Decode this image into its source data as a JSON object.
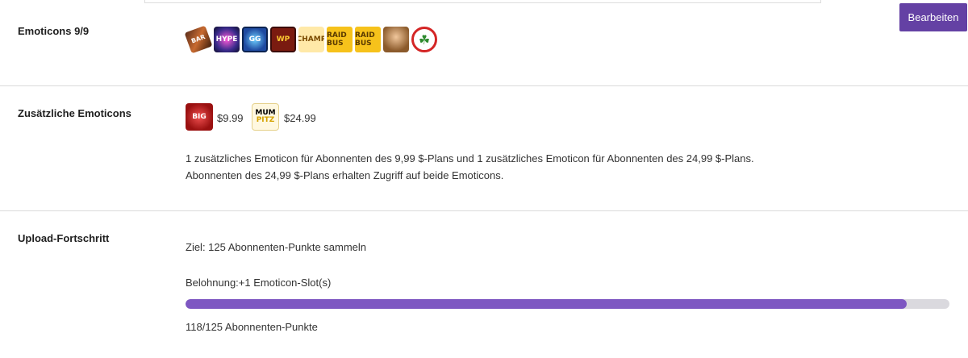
{
  "header": {
    "edit_label": "Bearbeiten"
  },
  "emoticons": {
    "label": "Emoticons 9/9",
    "items": [
      {
        "name": "candy-bar-emote",
        "text": "BAR"
      },
      {
        "name": "hype-emote",
        "text": "HYPE"
      },
      {
        "name": "gg-emote",
        "text": "GG"
      },
      {
        "name": "wp-emote",
        "text": "WP"
      },
      {
        "name": "champ-emote",
        "text": "CHAMP"
      },
      {
        "name": "raid-bus-emote-1",
        "text": "RAID BUS"
      },
      {
        "name": "raid-bus-emote-2",
        "text": "RAID BUS"
      },
      {
        "name": "face-emote",
        "text": ""
      },
      {
        "name": "clover-emote",
        "text": "☘"
      }
    ]
  },
  "additional": {
    "label": "Zusätzliche Emoticons",
    "tier1": {
      "emote_text": "BIG",
      "price": "$9.99"
    },
    "tier2": {
      "emote_text_top": "MUM",
      "emote_text_bottom": "PITZ",
      "price": "$24.99"
    },
    "description_line1": "1 zusätzliches Emoticon für Abonnenten des 9,99 $-Plans und 1 zusätzliches Emoticon für Abonnenten des 24,99 $-Plans.",
    "description_line2": "Abonnenten des 24,99 $-Plans erhalten Zugriff auf beide Emoticons."
  },
  "upload": {
    "label": "Upload-Fortschritt",
    "goal": "Ziel: 125 Abonnenten-Punkte sammeln",
    "reward": "Belohnung:+1 Emoticon-Slot(s)",
    "progress_value": 118,
    "progress_max": 125,
    "progress_text": "118/125 Abonnenten-Punkte"
  },
  "colors": {
    "accent": "#6441a4",
    "progress_fill": "#7e57c2",
    "progress_track": "#dad9de"
  }
}
